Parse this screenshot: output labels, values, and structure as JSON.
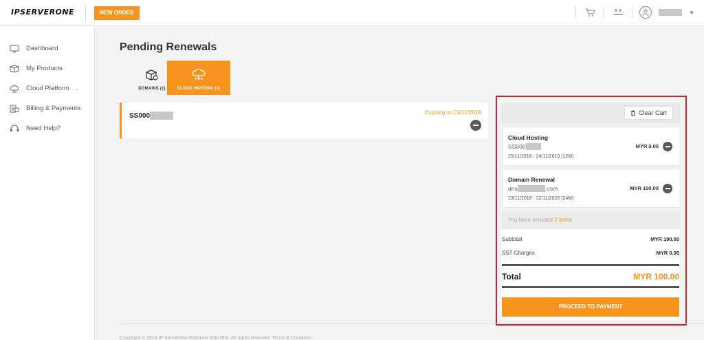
{
  "header": {
    "logo_text": "IPSERVERONE",
    "new_order_label": "NEW ORDER"
  },
  "sidebar": {
    "items": [
      {
        "label": "Dashboard",
        "icon": "monitor-icon"
      },
      {
        "label": "My Products",
        "icon": "box-icon"
      },
      {
        "label": "Cloud Platform",
        "icon": "cloud-icon"
      },
      {
        "label": "Billing & Payments",
        "icon": "billing-icon"
      },
      {
        "label": "Need Help?",
        "icon": "headset-icon"
      }
    ]
  },
  "main": {
    "title": "Pending Renewals",
    "tabs": [
      {
        "label": "DOMAINS (1)",
        "icon": "server-box-icon",
        "active": false
      },
      {
        "label": "CLOUD HOSTING (1)",
        "icon": "cloud-network-icon",
        "active": true
      }
    ],
    "renewal": {
      "id_prefix": "SS000",
      "expiry": "Expiring on 24/11/2018"
    }
  },
  "cart": {
    "clear_label": "Clear Cart",
    "items": [
      {
        "title": "Cloud Hosting",
        "sub_prefix": "SS000",
        "sub_suffix": "",
        "dates": "25/11/2018 - 24/11/2019  (12M)",
        "price": "MYR 0.00"
      },
      {
        "title": "Domain Renewal",
        "sub_prefix": "dns",
        "sub_suffix": ".com",
        "dates": "23/11/2018 - 22/11/2020  (24M)",
        "price": "MYR 100.00"
      }
    ],
    "selected_prefix": "You have selected ",
    "selected_count": "2 items",
    "subtotal_label": "Subtotal",
    "subtotal_value": "MYR 100.00",
    "sst_label": "SST Charges",
    "sst_value": "MYR 0.00",
    "total_label": "Total",
    "total_value": "MYR 100.00",
    "proceed_label": "PROCEED TO PAYMENT"
  },
  "footer": {
    "text": "Copyright © 2018 IP ServerOne Solutions Sdn Bhd. All rights reserved. Terms & Condition"
  },
  "colors": {
    "accent": "#f7941d",
    "highlight_outline": "#d4202b"
  }
}
